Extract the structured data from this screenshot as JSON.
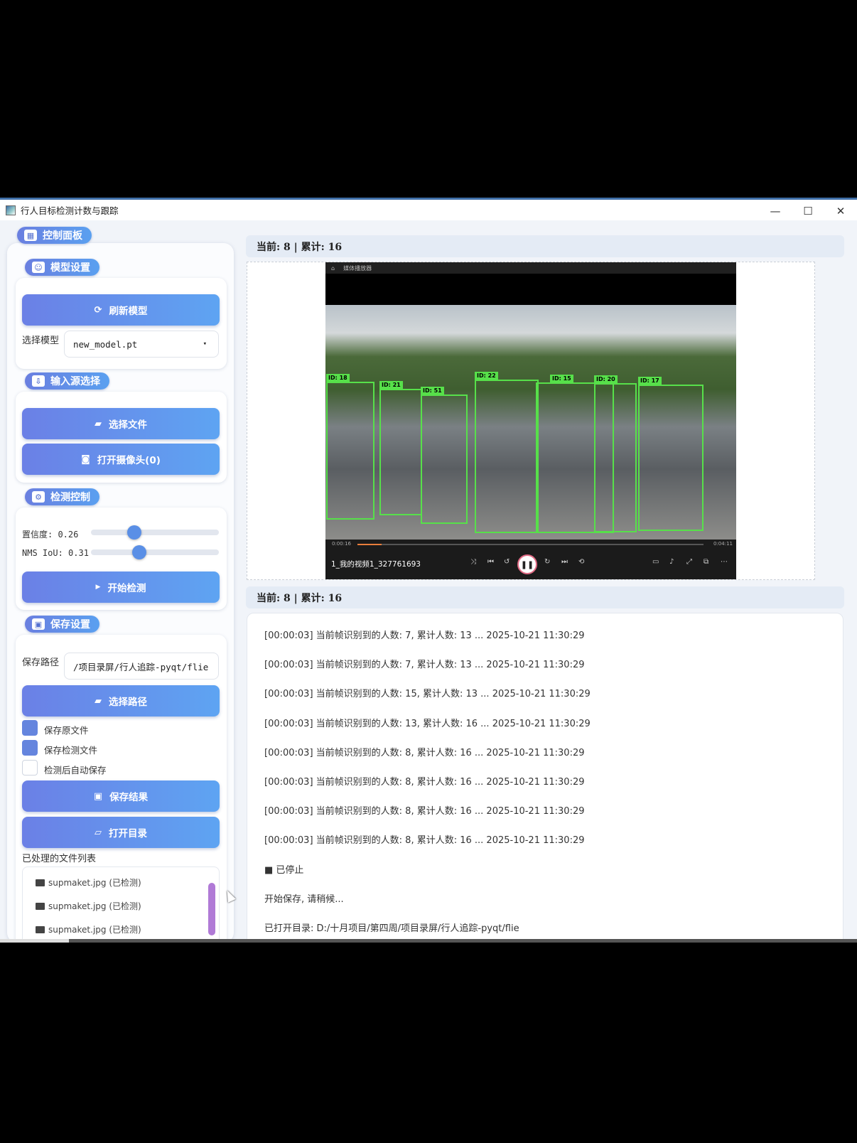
{
  "window": {
    "title": "行人目标检测计数与跟踪",
    "min": "—",
    "max": "☐",
    "close": "✕"
  },
  "control_panel": {
    "title": "控制面板",
    "model_settings": {
      "title": "模型设置",
      "refresh_button": "刷新模型",
      "select_label": "选择模型",
      "model_value": "new_model.pt"
    },
    "input_source": {
      "title": "输入源选择",
      "select_file_button": "选择文件",
      "open_camera_button": "打开摄像头(0)"
    },
    "detection_control": {
      "title": "检测控制",
      "confidence_label": "置信度: 0.26",
      "confidence_value": 0.26,
      "nms_label": "NMS IoU: 0.31",
      "nms_value": 0.31,
      "start_button": "开始检测"
    },
    "save_settings": {
      "title": "保存设置",
      "path_label": "保存路径",
      "path_value": "/项目录屏/行人追踪-pyqt/flie",
      "select_path_button": "选择路径",
      "checkboxes": [
        {
          "label": "保存原文件",
          "checked": true
        },
        {
          "label": "保存检测文件",
          "checked": true
        },
        {
          "label": "检测后自动保存",
          "checked": false
        }
      ],
      "save_result_button": "保存结果",
      "open_dir_button": "打开目录",
      "file_list_title": "已处理的文件列表",
      "files": [
        "supmaket.jpg (已检测)",
        "supmaket.jpg (已检测)",
        "supmaket.jpg (已检测)"
      ]
    }
  },
  "status_top": "当前: 8 | 累计: 16",
  "status_bottom": "当前: 8 | 累计: 16",
  "video": {
    "player_title": "媒体播放器",
    "filename": "1_我的视频1_327761693",
    "time_current": "0:00:16",
    "time_total": "0:04:11",
    "progress": 0.07,
    "boxes": [
      "ID: 18",
      "ID: 21",
      "ID: 51",
      "ID: 22",
      "ID: 15",
      "ID: 20",
      "ID: 17"
    ]
  },
  "log": [
    "[00:00:03] 当前帧识别到的人数: 7, 累计人数: 13 ... 2025-10-21 11:30:29",
    "[00:00:03] 当前帧识别到的人数: 7, 累计人数: 13 ... 2025-10-21 11:30:29",
    "[00:00:03] 当前帧识别到的人数: 15, 累计人数: 13 ... 2025-10-21 11:30:29",
    "[00:00:03] 当前帧识别到的人数: 13, 累计人数: 16 ... 2025-10-21 11:30:29",
    "[00:00:03] 当前帧识别到的人数: 8, 累计人数: 16 ... 2025-10-21 11:30:29",
    "[00:00:03] 当前帧识别到的人数: 8, 累计人数: 16 ... 2025-10-21 11:30:29",
    "[00:00:03] 当前帧识别到的人数: 8, 累计人数: 16 ... 2025-10-21 11:30:29",
    "[00:00:03] 当前帧识别到的人数: 8, 累计人数: 16 ... 2025-10-21 11:30:29",
    "■ 已停止",
    "开始保存, 请稍候...",
    "已打开目录: D:/十月项目/第四周/项目录屏/行人追踪-pyqt/flie"
  ]
}
